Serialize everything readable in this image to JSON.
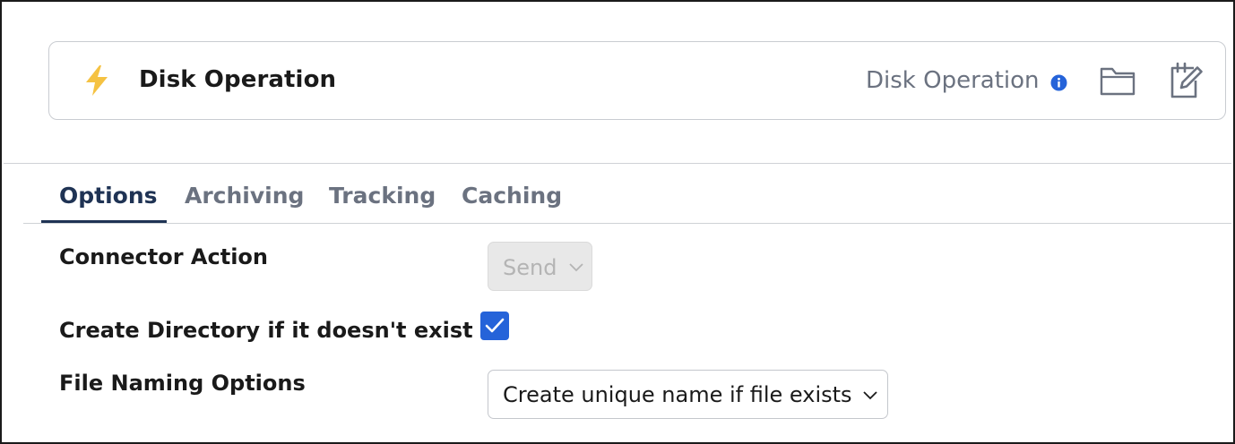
{
  "header": {
    "title": "Disk Operation",
    "operation_type": "Disk Operation",
    "title_icon": "lightning-bolt-icon",
    "info_icon": "info-icon",
    "folder_icon": "folder-icon",
    "edit_icon": "edit-icon"
  },
  "tabs": [
    {
      "label": "Options",
      "active": true
    },
    {
      "label": "Archiving",
      "active": false
    },
    {
      "label": "Tracking",
      "active": false
    },
    {
      "label": "Caching",
      "active": false
    }
  ],
  "form": {
    "connector_action": {
      "label": "Connector Action",
      "value": "Send",
      "disabled": true
    },
    "create_directory": {
      "label": "Create Directory if it doesn't exist",
      "checked": true
    },
    "file_naming": {
      "label": "File Naming Options",
      "value": "Create unique name if file exists"
    }
  },
  "colors": {
    "accent": "#2563d9",
    "bolt": "#f5c242",
    "active_tab": "#1f3354",
    "muted_text": "#6b7280"
  }
}
